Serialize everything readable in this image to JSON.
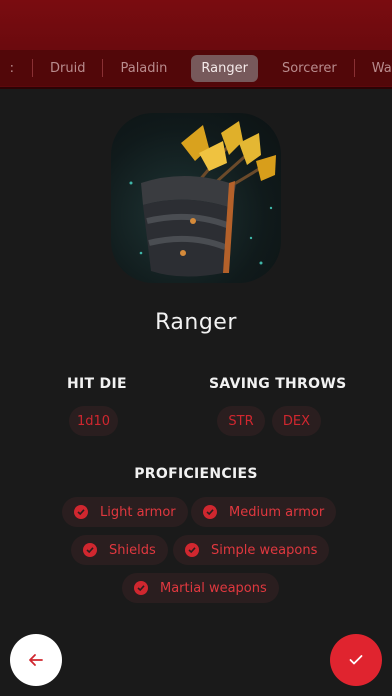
{
  "tabs": {
    "items": [
      {
        "label": "Druid"
      },
      {
        "label": "Paladin"
      },
      {
        "label": "Ranger"
      },
      {
        "label": "Sorcerer"
      },
      {
        "label": "Warlock"
      }
    ],
    "active_index": 2
  },
  "class": {
    "name": "Ranger",
    "portrait_icon": "quiver-arrows-icon"
  },
  "hit_die": {
    "heading": "HIT DIE",
    "value": "1d10"
  },
  "saving_throws": {
    "heading": "SAVING THROWS",
    "values": [
      "STR",
      "DEX"
    ]
  },
  "proficiencies": {
    "heading": "PROFICIENCIES",
    "items": [
      "Light armor",
      "Medium armor",
      "Shields",
      "Simple weapons",
      "Martial weapons"
    ]
  },
  "actions": {
    "back_icon": "arrow-left-icon",
    "confirm_icon": "checkmark-icon"
  },
  "colors": {
    "header": "#6a0a0e",
    "accent": "#e0242f",
    "chip_bg": "#2a1e1f",
    "background": "#1a1a1a"
  }
}
